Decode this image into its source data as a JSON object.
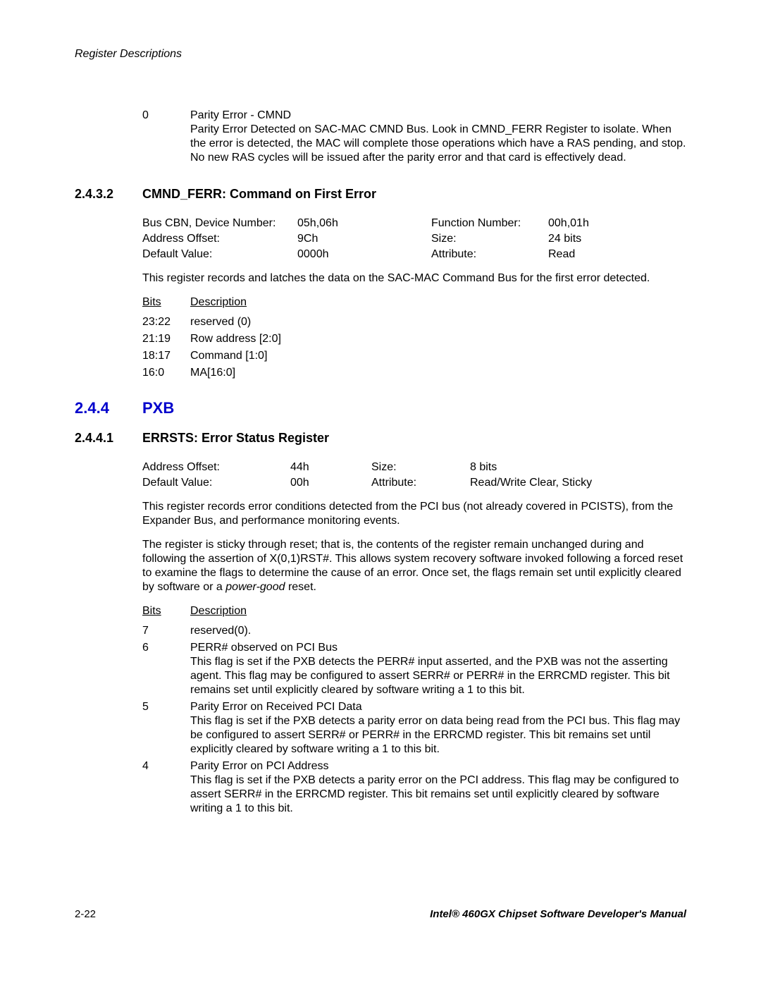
{
  "header": {
    "section": "Register Descriptions"
  },
  "bit0": {
    "bit": "0",
    "title": "Parity Error - CMND",
    "body": "Parity Error Detected on SAC-MAC CMND Bus. Look in CMND_FERR Register to isolate. When the error is detected, the MAC will complete those operations which have a RAS pending, and stop. No new RAS cycles will be issued after the parity error and that card is effectively dead."
  },
  "sec2432": {
    "num": "2.4.3.2",
    "title": "CMND_FERR: Command on First Error",
    "meta": {
      "row1": {
        "l1": "Bus CBN, Device Number:",
        "v1": "05h,06h",
        "l2": "Function Number:",
        "v2": "00h,01h"
      },
      "row2": {
        "l1": "Address Offset:",
        "v1": "9Ch",
        "l2": "Size:",
        "v2": "24 bits"
      },
      "row3": {
        "l1": "Default Value:",
        "v1": "0000h",
        "l2": "Attribute:",
        "v2": "Read"
      }
    },
    "para": "This register records and latches the data on the SAC-MAC Command Bus for the first error detected.",
    "bitheader": {
      "bits": "Bits",
      "desc": "Description"
    },
    "rows": [
      {
        "bit": "23:22",
        "desc": "reserved (0)"
      },
      {
        "bit": "21:19",
        "desc": "Row address [2:0]"
      },
      {
        "bit": "18:17",
        "desc": "Command [1:0]"
      },
      {
        "bit": "16:0",
        "desc": "MA[16:0]"
      }
    ]
  },
  "sec244": {
    "num": "2.4.4",
    "title": "PXB"
  },
  "sec2441": {
    "num": "2.4.4.1",
    "title": "ERRSTS: Error Status Register",
    "meta": {
      "row1": {
        "l1": "Address Offset:",
        "v1": "44h",
        "l2": "Size:",
        "v2": "8 bits"
      },
      "row2": {
        "l1": "Default Value:",
        "v1": "00h",
        "l2": "Attribute:",
        "v2": "Read/Write Clear, Sticky"
      }
    },
    "para1": "This register records error conditions detected from the PCI bus (not already covered in PCISTS), from the Expander Bus, and performance monitoring events.",
    "para2a": "The register is sticky through reset; that is, the contents of the register remain unchanged during and following the assertion of X(0,1)RST#. This allows system recovery software invoked following a forced reset to examine the flags to determine the cause of an error.   Once set, the flags remain set until explicitly cleared by software or a ",
    "para2b": "power-good",
    "para2c": " reset.",
    "bitheader": {
      "bits": "Bits",
      "desc": "Description"
    },
    "rows": [
      {
        "bit": "7",
        "title": "reserved(0).",
        "body": ""
      },
      {
        "bit": "6",
        "title": "PERR# observed on PCI Bus",
        "body": "This flag is set if the PXB detects the PERR# input asserted, and the PXB was not the asserting agent. This flag may be configured to assert SERR# or PERR# in the ERRCMD register. This bit remains set until explicitly cleared by software writing a 1 to this bit."
      },
      {
        "bit": "5",
        "title": "Parity Error on Received PCI Data",
        "body": "This flag is set if the PXB detects a parity error on data being read from the PCI bus. This flag may be configured to assert SERR# or PERR# in the ERRCMD register. This bit remains set until explicitly cleared by software writing a 1 to this bit."
      },
      {
        "bit": "4",
        "title": "Parity Error on PCI Address",
        "body": "This flag is set if the PXB detects a parity error on the PCI address. This flag may be configured to assert SERR# in the ERRCMD register. This bit remains set until explicitly cleared by software writing a 1 to this bit."
      }
    ]
  },
  "footer": {
    "page": "2-22",
    "title": "Intel® 460GX Chipset Software Developer's Manual"
  }
}
